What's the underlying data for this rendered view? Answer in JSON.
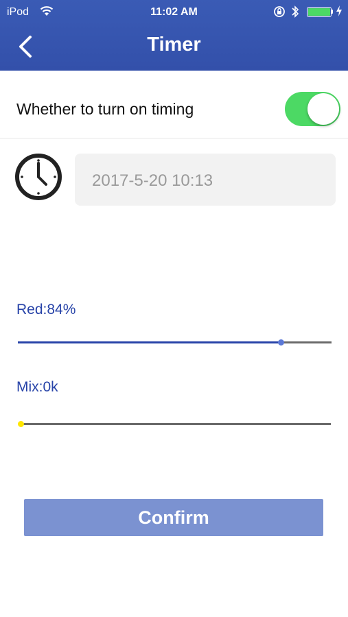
{
  "status_bar": {
    "carrier": "iPod",
    "time": "11:02 AM",
    "battery_color": "#4cd964"
  },
  "header": {
    "title": "Timer",
    "back_icon": "chevron-left-icon",
    "background": "#3a5bb5"
  },
  "timing": {
    "label": "Whether to turn on timing",
    "enabled": true,
    "switch_color": "#4cd964"
  },
  "schedule": {
    "icon": "clock-icon",
    "datetime": "2017-5-20 10:13"
  },
  "sliders": [
    {
      "label": "Red:84%",
      "value": 0.84,
      "track_color": "#2743a8",
      "thumb_color": "#5b78d6"
    },
    {
      "label": "Mix:0k",
      "value": 0.0,
      "track_color": "#2743a8",
      "thumb_color": "#ffe600"
    }
  ],
  "actions": {
    "confirm_label": "Confirm",
    "confirm_color": "#7b92d1"
  }
}
